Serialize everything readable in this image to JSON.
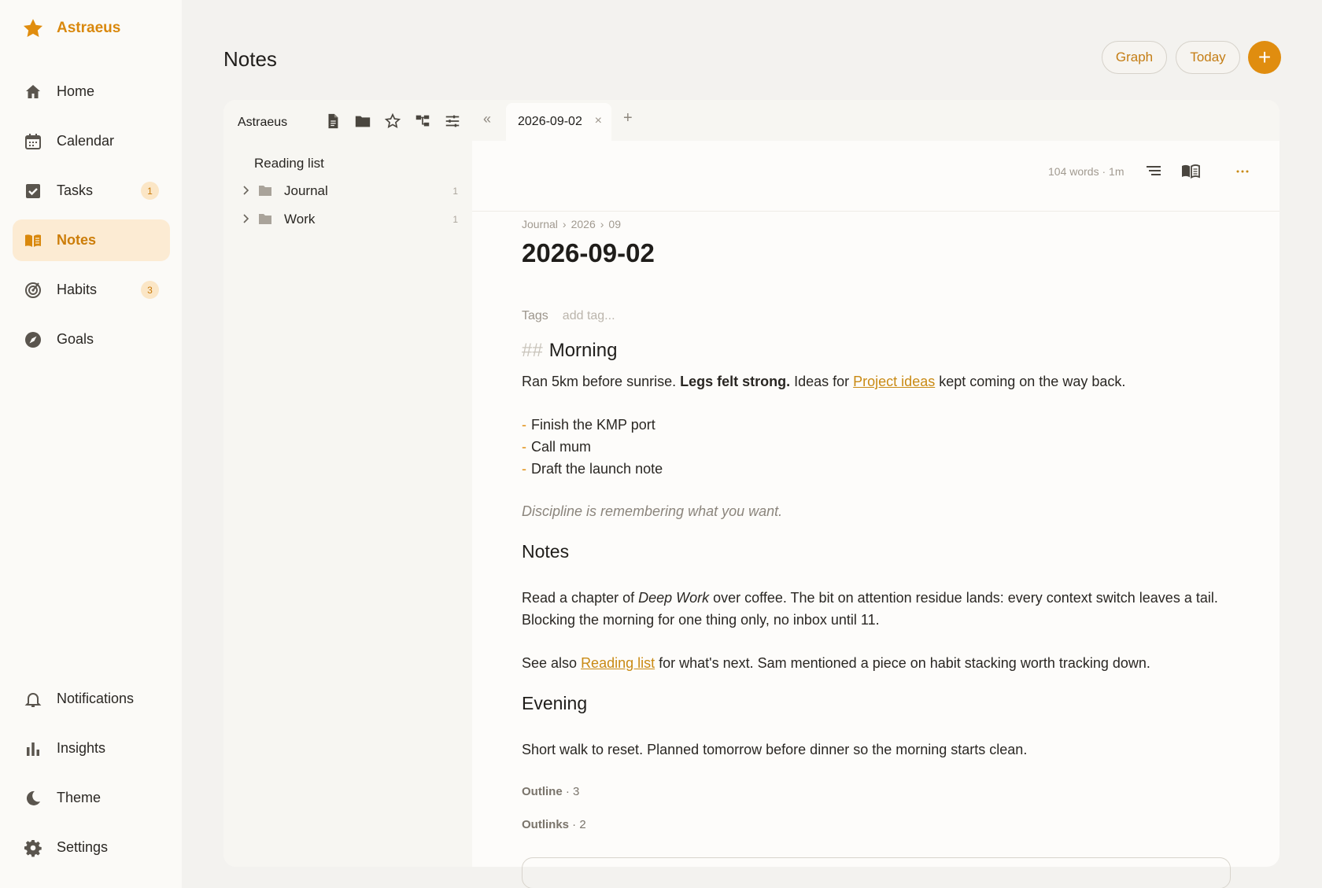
{
  "brand": {
    "name": "Astraeus"
  },
  "nav": {
    "items": [
      {
        "id": "home",
        "label": "Home",
        "icon": "home-icon"
      },
      {
        "id": "calendar",
        "label": "Calendar",
        "icon": "calendar-icon"
      },
      {
        "id": "tasks",
        "label": "Tasks",
        "icon": "checkbox-icon",
        "badge": "1"
      },
      {
        "id": "notes",
        "label": "Notes",
        "icon": "book-icon",
        "active": true
      },
      {
        "id": "habits",
        "label": "Habits",
        "icon": "target-icon",
        "badge": "3"
      },
      {
        "id": "goals",
        "label": "Goals",
        "icon": "compass-icon"
      }
    ],
    "bottom": [
      {
        "id": "notifications",
        "label": "Notifications",
        "icon": "bell-icon"
      },
      {
        "id": "insights",
        "label": "Insights",
        "icon": "bar-chart-icon"
      },
      {
        "id": "theme",
        "label": "Theme",
        "icon": "moon-icon"
      },
      {
        "id": "settings",
        "label": "Settings",
        "icon": "gear-icon"
      }
    ]
  },
  "header": {
    "title": "Notes",
    "graph_label": "Graph",
    "today_label": "Today",
    "add_label": "+"
  },
  "tree": {
    "vault_name": "Astraeus",
    "toolbar_icons": [
      "new-note-icon",
      "new-folder-icon",
      "star-icon",
      "tree-icon",
      "filter-icon"
    ],
    "plain_item": "Reading list",
    "folders": [
      {
        "label": "Journal",
        "count": "1"
      },
      {
        "label": "Work",
        "count": "1"
      }
    ]
  },
  "tabs": {
    "collapse": "«",
    "active_label": "2026-09-02",
    "close": "×",
    "add": "+"
  },
  "doc_toolbar": {
    "word_count": "104 words · 1m",
    "icons": [
      "outline-icon",
      "reading-mode-icon",
      "more-icon"
    ]
  },
  "doc": {
    "breadcrumb": [
      "Journal",
      "2026",
      "09"
    ],
    "breadcrumb_sep": "›",
    "title": "2026-09-02",
    "tags_label": "Tags",
    "tags_placeholder": "add tag...",
    "morning_hash": "##",
    "morning_heading": "Morning",
    "p1_a": "Ran 5km before sunrise. ",
    "p1_b": "Legs felt strong.",
    "p1_c": " Ideas for ",
    "p1_link": "Project ideas",
    "p1_d": " kept coming on the way back.",
    "bullet_marker": "-",
    "bullets": [
      "Finish the KMP port",
      "Call mum",
      "Draft the launch note"
    ],
    "quote": "Discipline is remembering what you want.",
    "notes_heading": "Notes",
    "p2_a": "Read a chapter of ",
    "p2_i": "Deep Work",
    "p2_b": " over coffee. The bit on attention residue lands: every context switch leaves a tail.",
    "p2_line2": "Blocking the morning for one thing only, no inbox until 11.",
    "p3_a": "See also ",
    "p3_link": "Reading list",
    "p3_b": " for what's next. Sam mentioned a piece on habit stacking worth tracking down.",
    "evening_heading": "Evening",
    "p4": "Short walk to reset. Planned tomorrow before dinner so the morning starts clean.",
    "outline_label": "Outline",
    "outline_count": " · 3",
    "outlinks_label": "Outlinks",
    "outlinks_count": " · 2"
  },
  "colors": {
    "accent": "#e08d0f",
    "accent_text": "#c98a14",
    "active_nav_bg": "#fcebd3"
  }
}
